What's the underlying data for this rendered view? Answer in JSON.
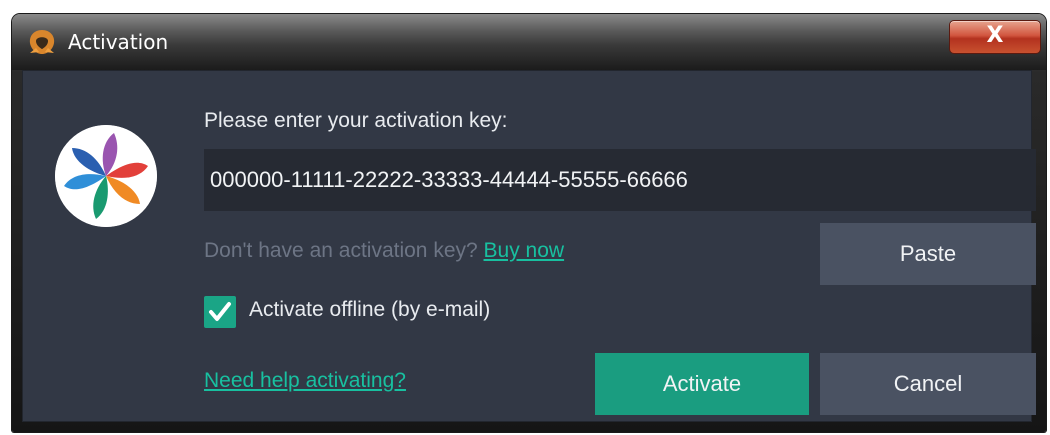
{
  "window": {
    "title": "Activation",
    "close_glyph": "X"
  },
  "dialog": {
    "key_prompt": "Please enter your activation key:",
    "key_value": "000000-11111-22222-33333-44444-55555-66666",
    "no_key_text": "Don't have an activation key?",
    "buy_now_label": "Buy now",
    "paste_label": "Paste",
    "offline_label": "Activate offline (by e-mail)",
    "offline_checked": true,
    "help_label": "Need help activating?",
    "activate_label": "Activate",
    "cancel_label": "Cancel"
  },
  "icons": {
    "title": "app-logo-icon",
    "dialog_logo": "pinwheel-logo-icon",
    "check": "checkmark-icon"
  },
  "colors": {
    "panel": "#323845",
    "field": "#262a33",
    "accent": "#1a9d80",
    "link": "#18c0a0",
    "button": "#4a5262",
    "muted_text": "#6d7585"
  }
}
